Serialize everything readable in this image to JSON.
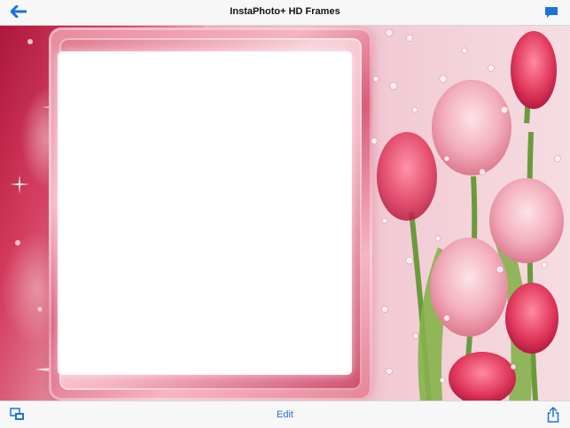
{
  "app": {
    "title": "InstaPhoto+ HD Frames"
  },
  "toolbar_top": {
    "back_icon": "back-arrow-icon",
    "chat_icon": "speech-bubble-icon"
  },
  "toolbar_bottom": {
    "gallery_icon": "gallery-icon",
    "edit_label": "Edit",
    "share_icon": "share-icon"
  },
  "theme": {
    "accent": "#1a73d9",
    "frame": "#e68a9f"
  }
}
